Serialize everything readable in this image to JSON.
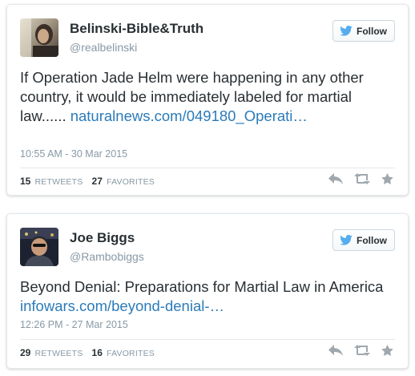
{
  "tweets": [
    {
      "name": "Belinski-Bible&Truth",
      "handle": "@realbelinski",
      "follow_label": "Follow",
      "text": "If Operation Jade Helm were happening in any other country, it would be immediately labeled for martial law...... ",
      "link": "naturalnews.com/049180_Operati…",
      "timestamp": "10:55 AM - 30 Mar 2015",
      "retweets_count": "15",
      "retweets_label": "RETWEETS",
      "favorites_count": "27",
      "favorites_label": "FAVORITES"
    },
    {
      "name": "Joe Biggs",
      "handle": "@Rambobiggs",
      "follow_label": "Follow",
      "text": "Beyond Denial: Preparations for Martial Law in America ",
      "link": "infowars.com/beyond-denial-…",
      "timestamp": "12:26 PM - 27 Mar 2015",
      "retweets_count": "29",
      "retweets_label": "RETWEETS",
      "favorites_count": "16",
      "favorites_label": "FAVORITES"
    }
  ],
  "icons": {
    "twitter_bird": "twitter-bird-icon",
    "reply": "reply-icon",
    "retweet": "retweet-icon",
    "favorite": "star-icon"
  },
  "colors": {
    "link": "#2b7bb9",
    "twitter_blue": "#55acee",
    "muted": "#8899a6",
    "text": "#292f33",
    "action_icon": "#a0a8ae"
  }
}
